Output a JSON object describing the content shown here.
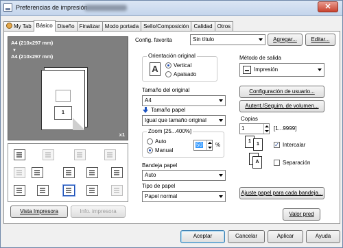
{
  "window": {
    "title": "Preferencias de impresión",
    "close_label": "✕"
  },
  "tabs": [
    {
      "label": "My Tab"
    },
    {
      "label": "Básico"
    },
    {
      "label": "Diseño"
    },
    {
      "label": "Finalizar"
    },
    {
      "label": "Modo portada"
    },
    {
      "label": "Sello/Composición"
    },
    {
      "label": "Calidad"
    },
    {
      "label": "Otros"
    }
  ],
  "preview": {
    "line1": "A4 (210x297 mm)",
    "arrow": "▼",
    "line2": "A4 (210x297 mm)",
    "page_number": "1",
    "copies_badge": "x1",
    "printer_view_button": "Vista Impresora",
    "printer_info_button": "Info. impresora"
  },
  "config": {
    "label": "Config. favorita",
    "value": "Sin título",
    "add_button": "Agregar...",
    "edit_button": "Editar..."
  },
  "orientation": {
    "title": "Orientación original",
    "portrait": "Vertical",
    "landscape": "Apaisado",
    "selected": "Vertical",
    "icon_letter": "A"
  },
  "original_size": {
    "label": "Tamaño del original",
    "value": "A4"
  },
  "paper_size": {
    "label": "Tamaño papel",
    "value": "Igual que tamaño original"
  },
  "zoom": {
    "title": "Zoom [25...400%]",
    "auto": "Auto",
    "manual": "Manual",
    "selected": "Manual",
    "value": "50",
    "unit": "%"
  },
  "paper_tray": {
    "label": "Bandeja papel",
    "value": "Auto"
  },
  "paper_type": {
    "label": "Tipo de papel",
    "value": "Papel normal"
  },
  "output": {
    "label": "Método de salida",
    "value": "Impresión",
    "user_settings_button": "Configuración de usuario...",
    "auth_button": "Autent./Seguim. de volumen..."
  },
  "copies": {
    "label": "Copias",
    "value": "1",
    "range": "[1...9999]",
    "collate": "Intercalar",
    "collate_checked": true,
    "offset": "Separación",
    "offset_checked": false
  },
  "adjust_button": "Ajuste papel para cada bandeja...",
  "defaults_button": "Valor pred",
  "footer": {
    "ok": "Aceptar",
    "cancel": "Cancelar",
    "apply": "Aplicar",
    "help": "Ayuda"
  }
}
